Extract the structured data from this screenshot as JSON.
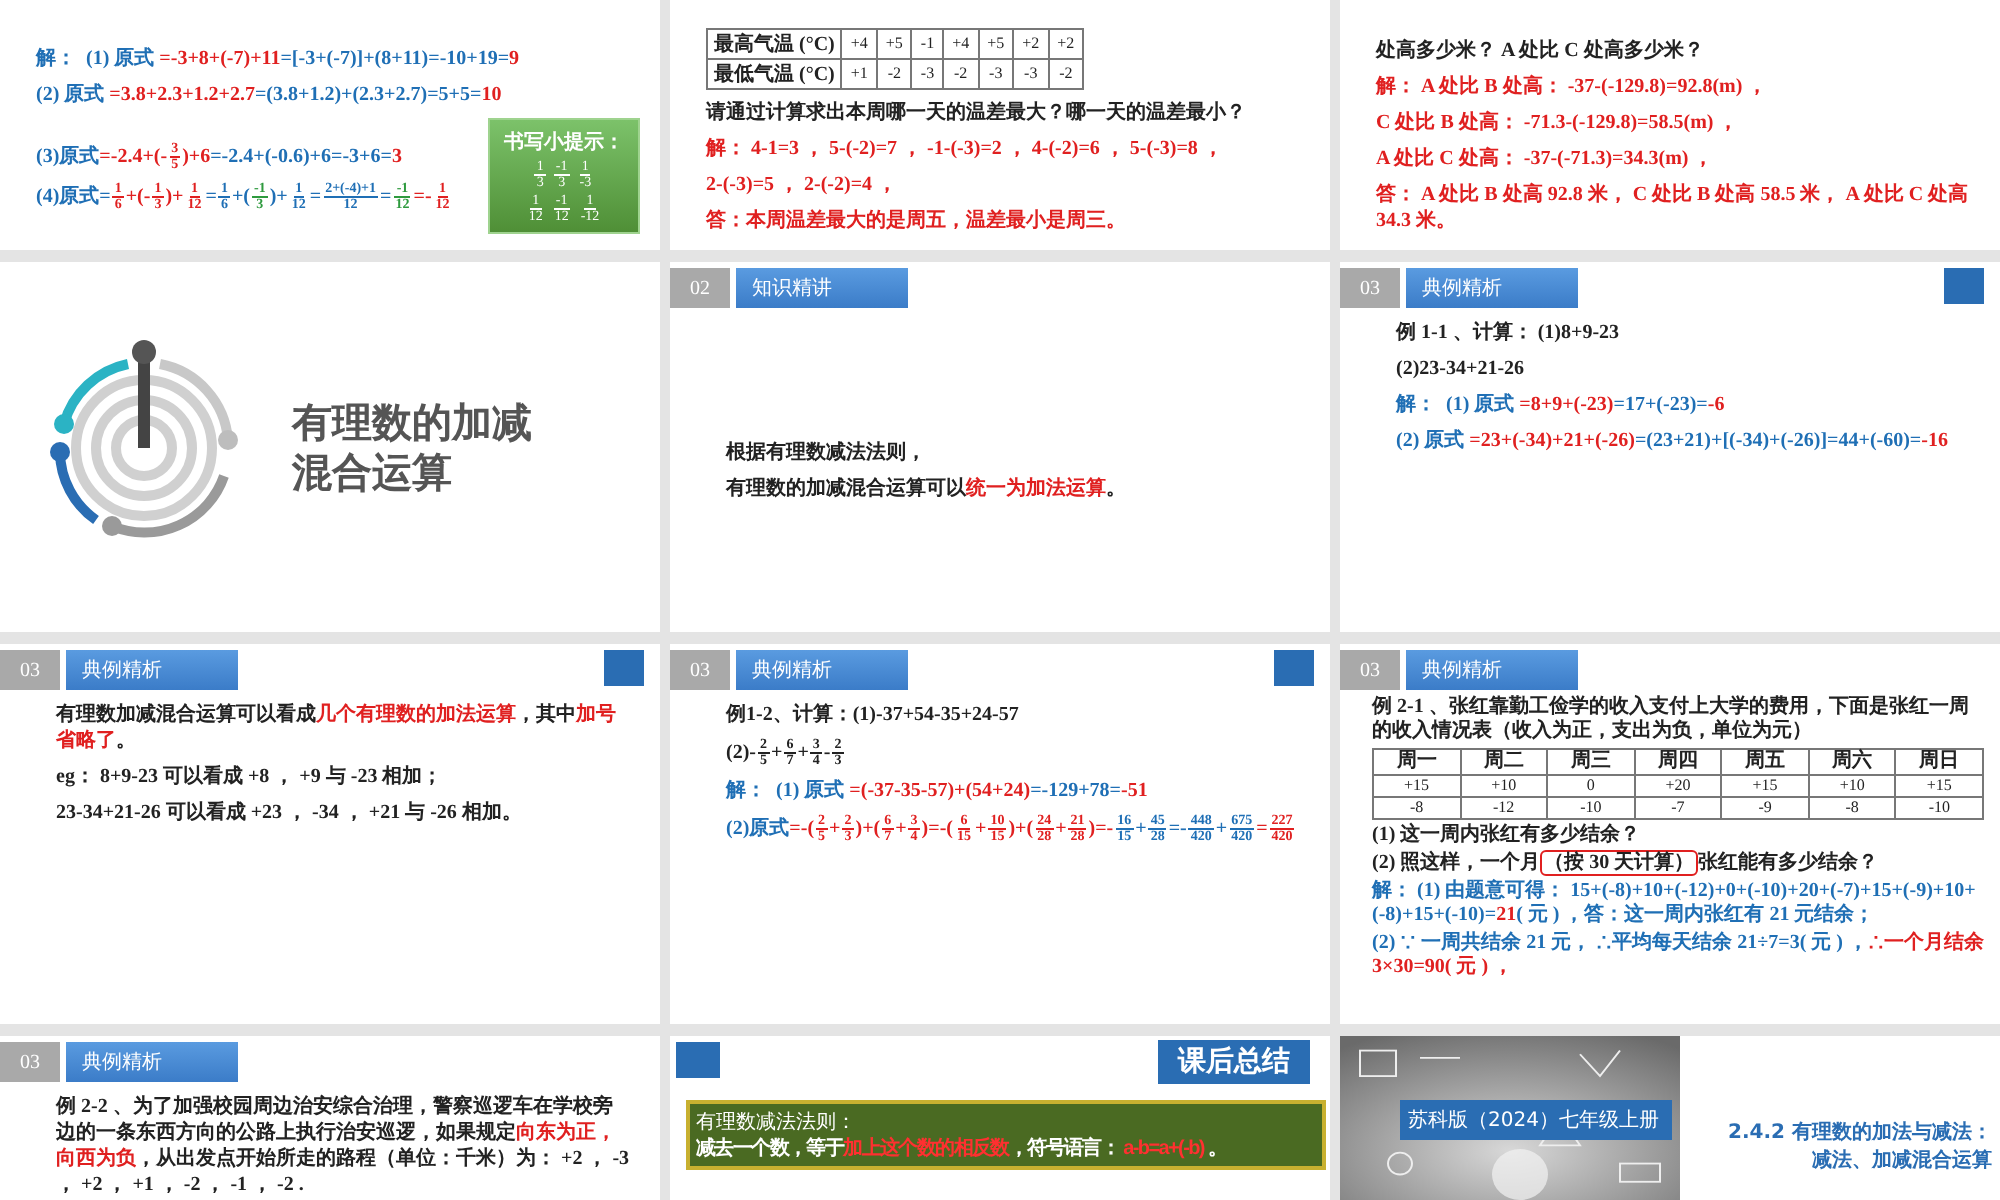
{
  "slides": [
    {
      "kind": "continued",
      "blocks": [
        {
          "kind": "line",
          "parts": [
            {
              "text": "解：  (1) 原式 ",
              "color": "#1f6fb5"
            },
            {
              "text": "=-3+8+(-7)+11",
              "color": "#e02020"
            },
            {
              "text": "=[-3+(-7)]+(8+11)=-10+19=",
              "color": "#1f6fb5"
            },
            {
              "text": "9",
              "color": "#e02020"
            }
          ]
        },
        {
          "kind": "line",
          "parts": [
            {
              "text": "(2) 原式 ",
              "color": "#1f6fb5"
            },
            {
              "text": "=3.8+2.3+1.2+2.7",
              "color": "#e02020"
            },
            {
              "text": "=(3.8+1.2)+(2.3+2.7)=5+5=",
              "color": "#1f6fb5"
            },
            {
              "text": "10",
              "color": "#e02020"
            }
          ]
        },
        {
          "kind": "tip",
          "title": "书写小提示：",
          "rows": [
            [
              {
                "numerator": "1",
                "denominator": "3"
              },
              {
                "numerator": "-1",
                "denominator": "3"
              },
              {
                "numerator": "1",
                "denominator": "-3"
              }
            ],
            [
              {
                "numerator": "1",
                "denominator": "12"
              },
              {
                "numerator": "-1",
                "denominator": "12"
              },
              {
                "numerator": "1",
                "denominator": "-12"
              }
            ]
          ],
          "lines": [
            {
              "parts": [
                {
                  "text": "(3)原式",
                  "color": "#1f6fb5"
                },
                {
                  "text": "=-2.4+(-",
                  "color": "#e02020"
                },
                {
                  "numerator": "3",
                  "denominator": "5",
                  "color": "#e02020"
                },
                {
                  "text": ")+6",
                  "color": "#e02020"
                },
                {
                  "text": "=-2.4+(-0.6)+6=-3+6=",
                  "color": "#1f6fb5"
                },
                {
                  "text": "3",
                  "color": "#e02020"
                }
              ]
            },
            {
              "parts": [
                {
                  "text": "(4)原式=",
                  "color": "#1f6fb5"
                },
                {
                  "numerator": "1",
                  "denominator": "6",
                  "color": "#e02020"
                },
                {
                  "text": "+(-",
                  "color": "#e02020"
                },
                {
                  "numerator": "1",
                  "denominator": "3",
                  "color": "#e02020"
                },
                {
                  "text": ")+",
                  "color": "#e02020"
                },
                {
                  "numerator": "1",
                  "denominator": "12",
                  "color": "#e02020"
                },
                {
                  "text": "=",
                  "color": "#1f6fb5"
                },
                {
                  "numerator": "1",
                  "denominator": "6",
                  "color": "#1f6fb5"
                },
                {
                  "text": "+(",
                  "color": "#1f6fb5"
                },
                {
                  "numerator": "-1",
                  "denominator": "3",
                  "color": "#2e9a3e"
                },
                {
                  "text": ")+",
                  "color": "#1f6fb5"
                },
                {
                  "numerator": "1",
                  "denominator": "12",
                  "color": "#1f6fb5"
                },
                {
                  "text": "=",
                  "color": "#1f6fb5"
                },
                {
                  "numerator": "2+(-4)+1",
                  "denominator": "12",
                  "color": "#1f6fb5"
                },
                {
                  "text": "=",
                  "color": "#1f6fb5"
                },
                {
                  "numerator": "-1",
                  "denominator": "12",
                  "color": "#2e9a3e"
                },
                {
                  "text": "=-",
                  "color": "#e02020"
                },
                {
                  "numerator": "1",
                  "denominator": "12",
                  "color": "#e02020"
                }
              ]
            }
          ]
        }
      ]
    },
    {
      "kind": "continued",
      "blocks": [
        {
          "kind": "table",
          "rows": [
            [
              "最高气温 (°C)",
              "+4",
              "+5",
              "-1",
              "+4",
              "+5",
              "+2",
              "+2"
            ],
            [
              "最低气温 (°C)",
              "+1",
              "-2",
              "-3",
              "-2",
              "-3",
              "-3",
              "-2"
            ]
          ]
        },
        {
          "kind": "line",
          "parts": [
            {
              "text": "请通过计算求出本周哪一天的温差最大？哪一天的温差最小？",
              "color": "#222222"
            }
          ]
        },
        {
          "kind": "line",
          "parts": [
            {
              "text": "解： 4-1=3 ， 5-(-2)=7 ， -1-(-3)=2 ， 4-(-2)=6 ， 5-(-3)=8 ，",
              "color": "#e02020"
            }
          ]
        },
        {
          "kind": "line",
          "parts": [
            {
              "text": "2-(-3)=5 ， 2-(-2)=4 ，",
              "color": "#e02020"
            }
          ]
        },
        {
          "kind": "line",
          "parts": [
            {
              "text": "答：本周温差最大的是周五，温差最小是周三。",
              "color": "#e02020"
            }
          ]
        }
      ]
    },
    {
      "kind": "continued",
      "blocks": [
        {
          "kind": "line",
          "parts": [
            {
              "text": "处高多少米？ A 处比 C 处高多少米？",
              "color": "#222222"
            }
          ]
        },
        {
          "kind": "line",
          "parts": [
            {
              "text": "解： A 处比 B 处高： -37-(-129.8)=92.8(m) ，",
              "color": "#e02020"
            }
          ]
        },
        {
          "kind": "line",
          "parts": [
            {
              "text": "C 处比 B 处高： -71.3-(-129.8)=58.5(m) ，",
              "color": "#e02020"
            }
          ]
        },
        {
          "kind": "line",
          "parts": [
            {
              "text": "A 处比 C 处高： -37-(-71.3)=34.3(m) ，",
              "color": "#e02020"
            }
          ]
        },
        {
          "kind": "line",
          "parts": [
            {
              "text": "答： A 处比 B 处高 92.8 米， C 处比 B 处高 58.5 米， A 处比 C 处高 34.3 米。",
              "color": "#e02020"
            }
          ]
        }
      ]
    },
    {
      "kind": "title",
      "title": "有理数的加减混合运算"
    },
    {
      "kind": "statement",
      "accent": false,
      "header": {
        "number": "02",
        "title": "知识精讲"
      },
      "blocks": [
        {
          "kind": "line",
          "parts": [
            {
              "text": "根据有理数减法法则，",
              "color": "#222222"
            }
          ]
        },
        {
          "kind": "line",
          "parts": [
            {
              "text": "有理数的加减混合运算可以",
              "color": "#222222"
            },
            {
              "text": "统一为加法运算",
              "color": "#e02020"
            },
            {
              "text": "。",
              "color": "#222222"
            }
          ]
        }
      ]
    },
    {
      "kind": "content",
      "accent": true,
      "header": {
        "number": "03",
        "title": "典例精析"
      },
      "blocks": [
        {
          "kind": "line",
          "parts": [
            {
              "text": "例 1-1 、计算： (1)8+9-23",
              "color": "#222222"
            }
          ]
        },
        {
          "kind": "line",
          "parts": [
            {
              "text": "(2)23-34+21-26",
              "color": "#222222"
            }
          ]
        },
        {
          "kind": "line",
          "parts": [
            {
              "text": "解：  (1) 原式 ",
              "color": "#1f6fb5"
            },
            {
              "text": "=8+9+(-23)",
              "color": "#e02020"
            },
            {
              "text": "=17+(-23)=",
              "color": "#1f6fb5"
            },
            {
              "text": "-6",
              "color": "#e02020"
            }
          ]
        },
        {
          "kind": "line",
          "parts": [
            {
              "text": "(2) 原式 ",
              "color": "#1f6fb5"
            },
            {
              "text": "=23+(-34)+21+(-26)",
              "color": "#e02020"
            },
            {
              "text": "=(23+21)+[(-34)+(-26)]=44+(-60)=",
              "color": "#1f6fb5"
            },
            {
              "text": "-16",
              "color": "#e02020"
            }
          ]
        }
      ]
    },
    {
      "kind": "content",
      "accent": true,
      "header": {
        "number": "03",
        "title": "典例精析"
      },
      "blocks": [
        {
          "kind": "line",
          "parts": [
            {
              "text": "有理数加减混合运算可以看成",
              "color": "#222222"
            },
            {
              "text": "几个有理数的加法运算",
              "color": "#e02020"
            },
            {
              "text": "，其中",
              "color": "#222222"
            },
            {
              "text": "加号省略了",
              "color": "#e02020"
            },
            {
              "text": "。",
              "color": "#222222"
            }
          ]
        },
        {
          "kind": "line",
          "parts": [
            {
              "text": "eg： 8+9-23 可以看成 +8 ， +9 与 -23 相加；",
              "color": "#222222"
            }
          ]
        },
        {
          "kind": "line",
          "parts": [
            {
              "text": "23-34+21-26 可以看成 +23 ， -34 ， +21 与 -26 相加。",
              "color": "#222222"
            }
          ]
        }
      ]
    },
    {
      "kind": "content",
      "accent": true,
      "header": {
        "number": "03",
        "title": "典例精析"
      },
      "blocks": [
        {
          "kind": "line",
          "parts": [
            {
              "text": "例1-2、计算：(1)-37+54-35+24-57",
              "color": "#222222"
            }
          ]
        },
        {
          "kind": "line",
          "parts": [
            {
              "text": "(2)-",
              "color": "#222222"
            },
            {
              "numerator": "2",
              "denominator": "5",
              "color": "#222222"
            },
            {
              "text": "+",
              "color": "#222222"
            },
            {
              "numerator": "6",
              "denominator": "7",
              "color": "#222222"
            },
            {
              "text": "+",
              "color": "#222222"
            },
            {
              "numerator": "3",
              "denominator": "4",
              "color": "#222222"
            },
            {
              "text": "-",
              "color": "#222222"
            },
            {
              "numerator": "2",
              "denominator": "3",
              "color": "#222222"
            }
          ]
        },
        {
          "kind": "line",
          "parts": [
            {
              "text": "解：  (1) 原式 ",
              "color": "#1f6fb5"
            },
            {
              "text": "=(-37-35-57)+(54+24)",
              "color": "#e02020"
            },
            {
              "text": "=-129+78=",
              "color": "#1f6fb5"
            },
            {
              "text": "-51",
              "color": "#e02020"
            }
          ]
        },
        {
          "kind": "line",
          "parts": [
            {
              "text": "(2)原式",
              "color": "#1f6fb5"
            },
            {
              "text": "=-(",
              "color": "#e02020"
            },
            {
              "numerator": "2",
              "denominator": "5",
              "color": "#e02020"
            },
            {
              "text": "+",
              "color": "#e02020"
            },
            {
              "numerator": "2",
              "denominator": "3",
              "color": "#e02020"
            },
            {
              "text": ")+(",
              "color": "#e02020"
            },
            {
              "numerator": "6",
              "denominator": "7",
              "color": "#e02020"
            },
            {
              "text": "+",
              "color": "#e02020"
            },
            {
              "numerator": "3",
              "denominator": "4",
              "color": "#e02020"
            },
            {
              "text": ")=-(",
              "color": "#e02020"
            },
            {
              "numerator": "6",
              "denominator": "15",
              "color": "#e02020"
            },
            {
              "text": "+",
              "color": "#e02020"
            },
            {
              "numerator": "10",
              "denominator": "15",
              "color": "#e02020"
            },
            {
              "text": ")+(",
              "color": "#e02020"
            },
            {
              "numerator": "24",
              "denominator": "28",
              "color": "#e02020"
            },
            {
              "text": "+",
              "color": "#e02020"
            },
            {
              "numerator": "21",
              "denominator": "28",
              "color": "#e02020"
            },
            {
              "text": ")=-",
              "color": "#e02020"
            },
            {
              "numerator": "16",
              "denominator": "15",
              "color": "#1f6fb5"
            },
            {
              "text": "+",
              "color": "#1f6fb5"
            },
            {
              "numerator": "45",
              "denominator": "28",
              "color": "#1f6fb5"
            },
            {
              "text": "=-",
              "color": "#1f6fb5"
            },
            {
              "numerator": "448",
              "denominator": "420",
              "color": "#1f6fb5"
            },
            {
              "text": "+",
              "color": "#1f6fb5"
            },
            {
              "numerator": "675",
              "denominator": "420",
              "color": "#1f6fb5"
            },
            {
              "text": "=",
              "color": "#e02020"
            },
            {
              "numerator": "227",
              "denominator": "420",
              "color": "#e02020"
            }
          ]
        }
      ]
    },
    {
      "kind": "dense",
      "accent": false,
      "header": {
        "number": "03",
        "title": "典例精析"
      },
      "blocks": [
        {
          "kind": "line",
          "parts": [
            {
              "text": "例 2-1 、张红靠勤工俭学的收入支付上大学的费用，下面是张红一周的收入情况表（收入为正，支出为负，单位为元）",
              "color": "#222222"
            }
          ]
        },
        {
          "kind": "table",
          "header": [
            "周一",
            "周二",
            "周三",
            "周四",
            "周五",
            "周六",
            "周日"
          ],
          "rows": [
            [
              "+15",
              "+10",
              "0",
              "+20",
              "+15",
              "+10",
              "+15"
            ],
            [
              "-8",
              "-12",
              "-10",
              "-7",
              "-9",
              "-8",
              "-10"
            ]
          ]
        },
        {
          "kind": "line",
          "parts": [
            {
              "text": "(1) 这一周内张红有多少结余？",
              "color": "#222222"
            }
          ]
        },
        {
          "kind": "line",
          "parts": [
            {
              "text": "(2) 照这样，一个月",
              "color": "#222222"
            },
            {
              "text": "（按 30 天计算）",
              "color": "#222222",
              "circled": true
            },
            {
              "text": "张红能有多少结余？",
              "color": "#222222"
            }
          ]
        },
        {
          "kind": "line",
          "parts": [
            {
              "text": "解： (1) 由题意可得： 15+(-8)+10+(-12)+0+(-10)+20+(-7)+15+(-9)+10+(-8)+15+(-10)=",
              "color": "#1f6fb5"
            },
            {
              "text": "21",
              "color": "#e02020"
            },
            {
              "text": "( 元 ) ，答：这一周内张红有 21 元结余；",
              "color": "#1f6fb5"
            }
          ]
        },
        {
          "kind": "line",
          "parts": [
            {
              "text": "(2) ∵ 一周共结余 21 元， ∴平均每天结余 21÷7=3( 元 ) ，",
              "color": "#1f6fb5"
            },
            {
              "text": "∴一个月结余 3×30=90( 元 ) ，",
              "color": "#e02020"
            }
          ]
        }
      ]
    },
    {
      "kind": "content",
      "accent": false,
      "header": {
        "number": "03",
        "title": "典例精析"
      },
      "blocks": [
        {
          "kind": "line",
          "parts": [
            {
              "text": "例 2-2 、为了加强校园周边治安综合治理，警察巡逻车在学校旁边的一条东西方向的公路上执行治安巡逻，如果规定",
              "color": "#222222"
            },
            {
              "text": "向东为正，向西为负",
              "color": "#e02020"
            },
            {
              "text": "，从出发点开始所走的路程（单位：千米）为： +2 ， -3 ， +2 ， +1 ， -2 ， -1 ， -2 .",
              "color": "#222222"
            }
          ]
        }
      ]
    },
    {
      "kind": "summary",
      "banner": "课后总结",
      "rule": {
        "title": "有理数减法法则：",
        "parts": [
          {
            "text": "减去一个数，等于",
            "color": "#ffffff"
          },
          {
            "text": "加上这个数的相反数",
            "color": "#ff3030"
          },
          {
            "text": "，符号语言： ",
            "color": "#ffffff"
          },
          {
            "text": "a-b=a+(-b)",
            "color": "#ff3030"
          },
          {
            "text": " 。",
            "color": "#ffffff"
          }
        ]
      }
    },
    {
      "kind": "cover",
      "edition": "苏科版（2024）七年级上册",
      "title": "2.4.2  有理数的加法与减法：",
      "subtitle": "减法、加减混合运算"
    }
  ]
}
